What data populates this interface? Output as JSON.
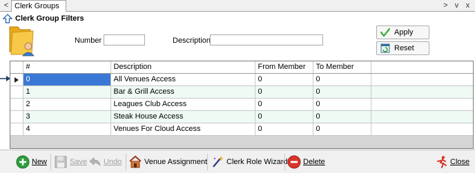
{
  "tabbar": {
    "back_label": "<",
    "tab_label": "Clerk Groups",
    "window_buttons": [
      ">",
      "v",
      "x"
    ]
  },
  "filters": {
    "title": "Clerk Group Filters",
    "number_label": "Number",
    "number_value": "",
    "description_label": "Description",
    "description_value": "",
    "apply_label": "Apply",
    "reset_label": "Reset"
  },
  "grid": {
    "columns": [
      "#",
      "Description",
      "From Member",
      "To Member"
    ],
    "rows": [
      [
        "0",
        "All Venues Access",
        "0",
        "0"
      ],
      [
        "1",
        "Bar & Grill Access",
        "0",
        "0"
      ],
      [
        "2",
        "Leagues Club Access",
        "0",
        "0"
      ],
      [
        "3",
        "Steak House Access",
        "0",
        "0"
      ],
      [
        "4",
        "Venues For Cloud Access",
        "0",
        "0"
      ]
    ],
    "selected_row": 0
  },
  "footer": {
    "new_label": "New",
    "save_label": "Save",
    "undo_label": "Undo",
    "venue_assignment_label": "Venue Assignment",
    "clerk_role_wizard_label": "Clerk Role Wizard",
    "delete_label": "Delete",
    "close_label": "Close"
  },
  "colors": {
    "selection": "#3a78d6",
    "alt_row": "#eefaf3",
    "grid_empty": "#d5d5d5",
    "apply_green": "#3cb043",
    "delete_red": "#d9342b",
    "new_green": "#2e9e3e"
  }
}
